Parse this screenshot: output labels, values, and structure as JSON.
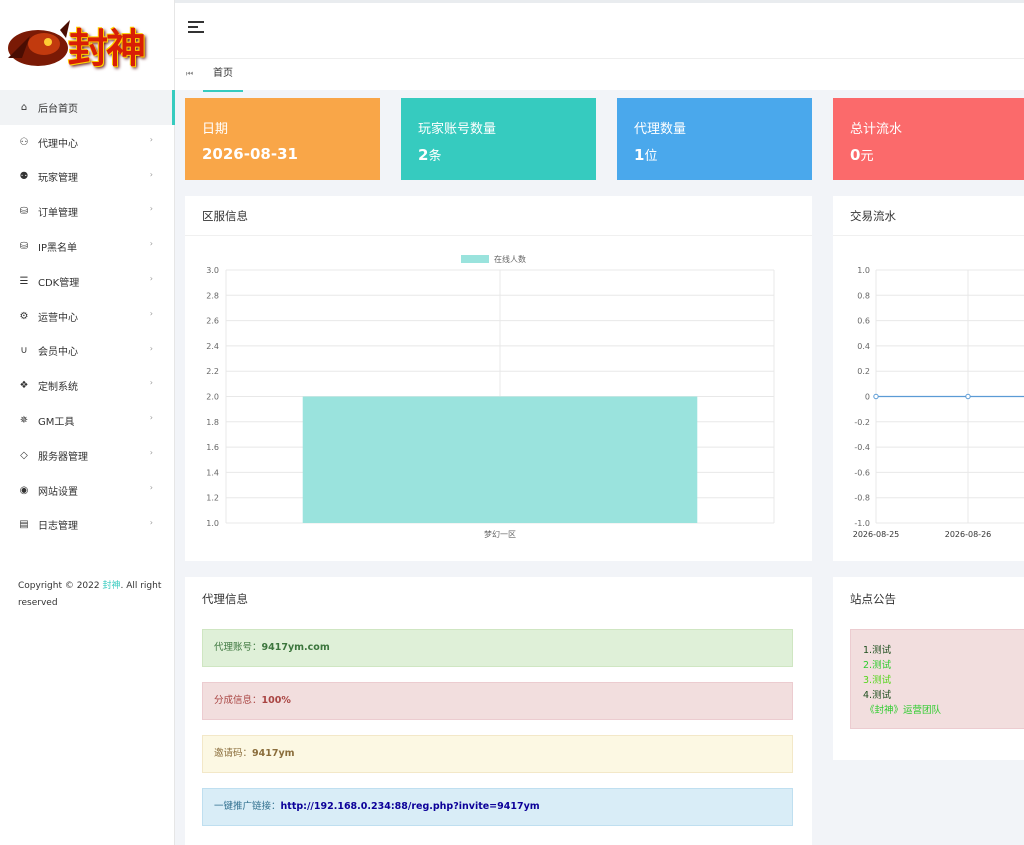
{
  "logo": {
    "text": "封神"
  },
  "sidebar": {
    "items": [
      {
        "label": "后台首页",
        "icon": "home-icon",
        "active": true
      },
      {
        "label": "代理中心",
        "icon": "users-outline-icon"
      },
      {
        "label": "玩家管理",
        "icon": "users-icon"
      },
      {
        "label": "订单管理",
        "icon": "database-plus-icon"
      },
      {
        "label": "IP黑名单",
        "icon": "database-plus-icon"
      },
      {
        "label": "CDK管理",
        "icon": "sort-lines-icon"
      },
      {
        "label": "运营中心",
        "icon": "gear-icon"
      },
      {
        "label": "会员中心",
        "icon": "magnet-icon"
      },
      {
        "label": "定制系统",
        "icon": "cubes-icon"
      },
      {
        "label": "GM工具",
        "icon": "bug-icon"
      },
      {
        "label": "服务器管理",
        "icon": "diamond-icon"
      },
      {
        "label": "网站设置",
        "icon": "globe-icon"
      },
      {
        "label": "日志管理",
        "icon": "chat-icon"
      }
    ],
    "copyright_prefix": "Copyright © 2022 ",
    "copyright_brand": "封神",
    "copyright_suffix": ". All right reserved"
  },
  "header": {
    "breadcrumb_tab": "首页"
  },
  "stats": [
    {
      "label": "日期",
      "value": "2026-08-31",
      "unit": "",
      "color": "#f9a648"
    },
    {
      "label": "玩家账号数量",
      "value": "2",
      "unit": "条",
      "color": "#36cbbf"
    },
    {
      "label": "代理数量",
      "value": "1",
      "unit": "位",
      "color": "#4aa8ec"
    },
    {
      "label": "总计流水",
      "value": "0",
      "unit": "元",
      "color": "#fb6a6b"
    }
  ],
  "server_panel": {
    "title": "区服信息"
  },
  "trade_panel": {
    "title": "交易流水"
  },
  "agent_panel": {
    "title": "代理信息",
    "rows": [
      {
        "label": "代理账号：",
        "value": "9417ym.com"
      },
      {
        "label": "分成信息：",
        "value": "100%"
      },
      {
        "label": "邀请码：",
        "value": "9417ym"
      },
      {
        "label": "一键推广链接：",
        "value": "http://192.168.0.234:88/reg.php?invite=9417ym"
      }
    ]
  },
  "notice_panel": {
    "title": "站点公告",
    "lines": [
      "1.测试",
      "2.测试",
      "3.测试",
      "4.测试",
      "《封神》运营团队"
    ]
  },
  "chart_data": [
    {
      "type": "bar",
      "legend": "在线人数",
      "legend_position": "top",
      "categories": [
        "梦幻一区"
      ],
      "series": [
        {
          "name": "在线人数",
          "values": [
            2.0
          ]
        }
      ],
      "ylim": [
        1.0,
        3.0
      ],
      "yticks": [
        "3.0",
        "2.8",
        "2.6",
        "2.4",
        "2.2",
        "2.0",
        "1.8",
        "1.6",
        "1.4",
        "1.2",
        "1.0"
      ],
      "grid": true,
      "color": "#9ae3dd"
    },
    {
      "type": "line",
      "x": [
        "2026-08-25",
        "2026-08-26"
      ],
      "series": [
        {
          "values": [
            0,
            0
          ]
        }
      ],
      "ylim": [
        -1.0,
        1.0
      ],
      "yticks": [
        "1.0",
        "0.8",
        "0.6",
        "0.4",
        "0.2",
        "0",
        "-0.2",
        "-0.4",
        "-0.6",
        "-0.8",
        "-1.0"
      ],
      "grid": true,
      "color": "#5b9bd5"
    }
  ]
}
